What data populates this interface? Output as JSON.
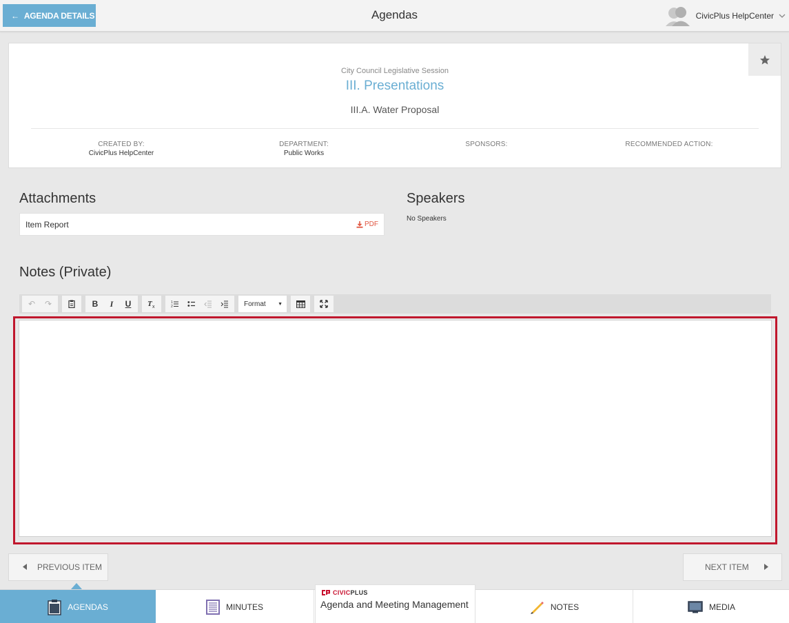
{
  "header": {
    "back_label": "AGENDA DETAILS",
    "title": "Agendas",
    "user_name": "CivicPlus HelpCenter"
  },
  "item": {
    "session": "City Council Legislative Session",
    "section": "III. Presentations",
    "title": "III.A. Water Proposal",
    "meta": [
      {
        "label": "CREATED BY:",
        "value": "CivicPlus HelpCenter"
      },
      {
        "label": "DEPARTMENT:",
        "value": "Public Works"
      },
      {
        "label": "SPONSORS:",
        "value": ""
      },
      {
        "label": "RECOMMENDED ACTION:",
        "value": ""
      }
    ]
  },
  "attachments": {
    "heading": "Attachments",
    "items": [
      {
        "name": "Item Report",
        "type": "PDF"
      }
    ]
  },
  "speakers": {
    "heading": "Speakers",
    "empty_text": "No Speakers"
  },
  "notes": {
    "heading": "Notes (Private)",
    "format_label": "Format",
    "content": ""
  },
  "pager": {
    "previous_label": "PREVIOUS ITEM",
    "next_label": "NEXT ITEM"
  },
  "bottom_nav": {
    "agendas": "AGENDAS",
    "minutes": "MINUTES",
    "brand_civic": "CIVIC",
    "brand_plus": "PLUS",
    "brand_product": "Agenda and Meeting Management",
    "notes": "NOTES",
    "media": "MEDIA"
  },
  "colors": {
    "accent": "#6aaed3",
    "highlight": "#c0172d",
    "pdf": "#e05540",
    "brand_red": "#c8102e"
  },
  "icons": [
    "arrow-left-icon",
    "user-avatar-icon",
    "chevron-down-icon",
    "star-icon",
    "download-icon",
    "undo-icon",
    "redo-icon",
    "paste-icon",
    "bold-icon",
    "italic-icon",
    "underline-icon",
    "remove-format-icon",
    "numbered-list-icon",
    "bulleted-list-icon",
    "outdent-icon",
    "indent-icon",
    "table-icon",
    "maximize-icon",
    "caret-left-icon",
    "caret-right-icon",
    "clipboard-icon",
    "minutes-list-icon",
    "pencil-icon",
    "monitor-icon",
    "civicplus-logo"
  ]
}
